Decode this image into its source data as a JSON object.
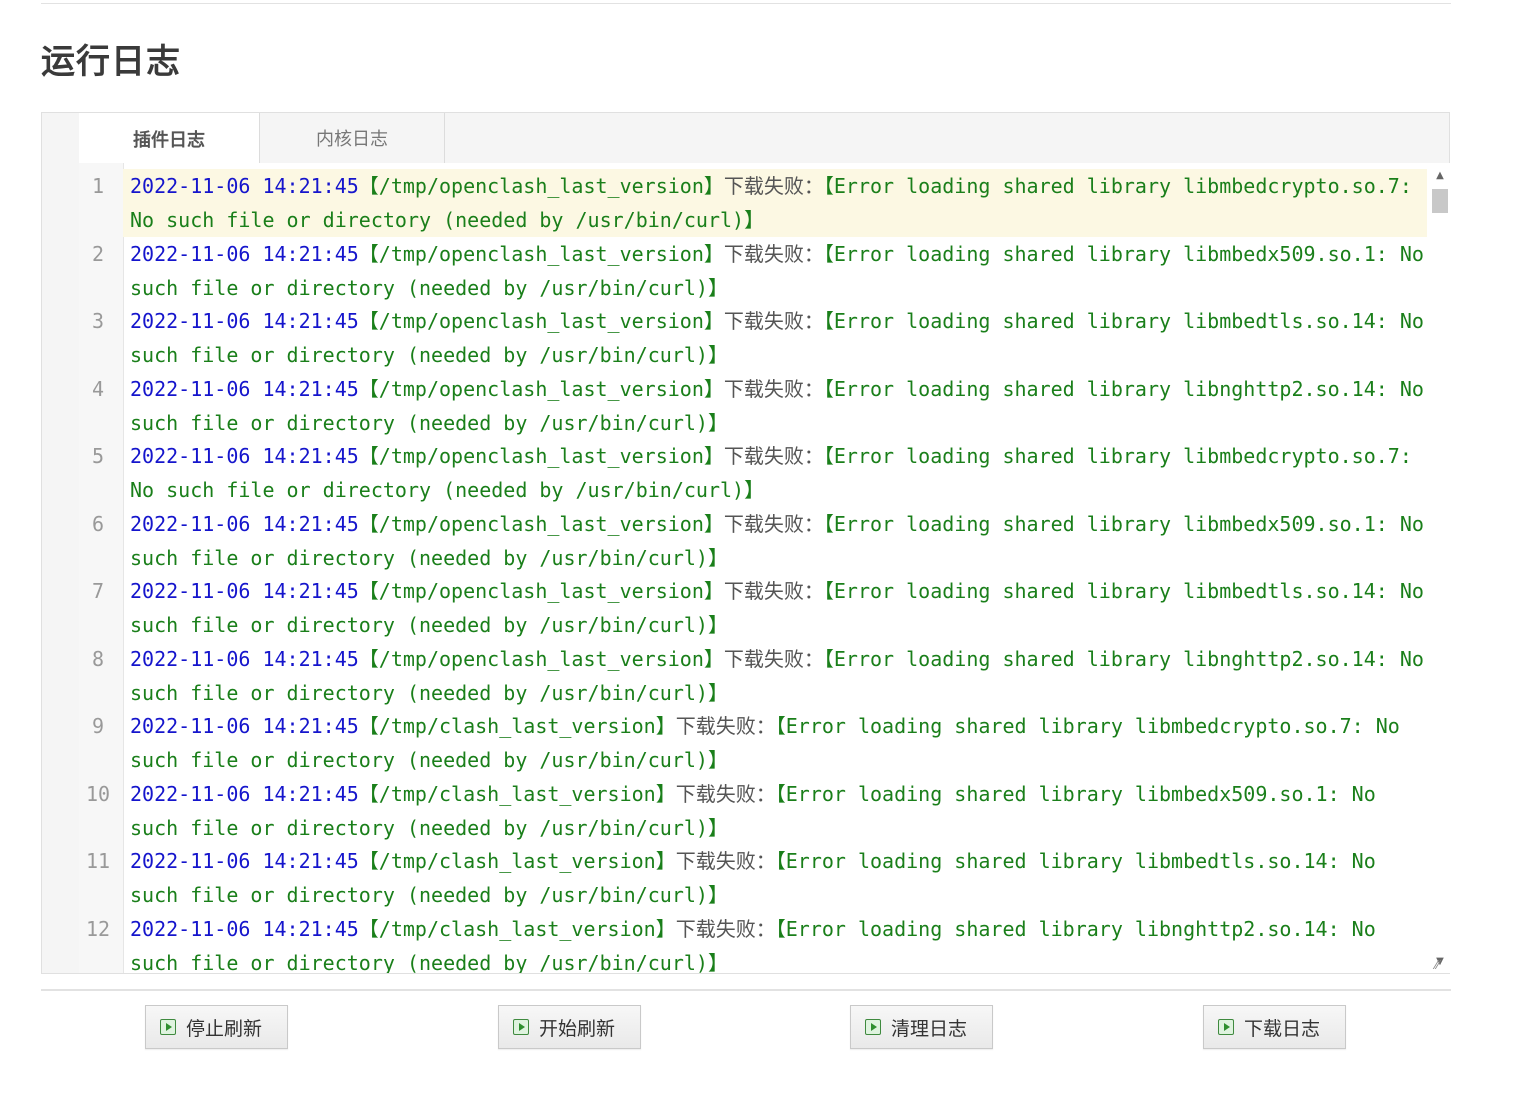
{
  "page": {
    "title": "运行日志"
  },
  "tabs": [
    {
      "label": "插件日志",
      "active": true
    },
    {
      "label": "内核日志",
      "active": false
    }
  ],
  "log_lines": [
    {
      "no": "1",
      "time": "2022-11-06 14:21:45",
      "path": "【/tmp/openclash_last_version】",
      "cn": "下载失败：",
      "msg": "【Error loading shared library libmbedcrypto.so.7: No such file or directory (needed by /usr/bin/curl)】"
    },
    {
      "no": "2",
      "time": "2022-11-06 14:21:45",
      "path": "【/tmp/openclash_last_version】",
      "cn": "下载失败：",
      "msg": "【Error loading shared library libmbedx509.so.1: No such file or directory (needed by /usr/bin/curl)】"
    },
    {
      "no": "3",
      "time": "2022-11-06 14:21:45",
      "path": "【/tmp/openclash_last_version】",
      "cn": "下载失败：",
      "msg": "【Error loading shared library libmbedtls.so.14: No such file or directory (needed by /usr/bin/curl)】"
    },
    {
      "no": "4",
      "time": "2022-11-06 14:21:45",
      "path": "【/tmp/openclash_last_version】",
      "cn": "下载失败：",
      "msg": "【Error loading shared library libnghttp2.so.14: No such file or directory (needed by /usr/bin/curl)】"
    },
    {
      "no": "5",
      "time": "2022-11-06 14:21:45",
      "path": "【/tmp/openclash_last_version】",
      "cn": "下载失败：",
      "msg": "【Error loading shared library libmbedcrypto.so.7: No such file or directory (needed by /usr/bin/curl)】"
    },
    {
      "no": "6",
      "time": "2022-11-06 14:21:45",
      "path": "【/tmp/openclash_last_version】",
      "cn": "下载失败：",
      "msg": "【Error loading shared library libmbedx509.so.1: No such file or directory (needed by /usr/bin/curl)】"
    },
    {
      "no": "7",
      "time": "2022-11-06 14:21:45",
      "path": "【/tmp/openclash_last_version】",
      "cn": "下载失败：",
      "msg": "【Error loading shared library libmbedtls.so.14: No such file or directory (needed by /usr/bin/curl)】"
    },
    {
      "no": "8",
      "time": "2022-11-06 14:21:45",
      "path": "【/tmp/openclash_last_version】",
      "cn": "下载失败：",
      "msg": "【Error loading shared library libnghttp2.so.14: No such file or directory (needed by /usr/bin/curl)】"
    },
    {
      "no": "9",
      "time": "2022-11-06 14:21:45",
      "path": "【/tmp/clash_last_version】",
      "cn": "下载失败：",
      "msg": "【Error loading shared library libmbedcrypto.so.7: No such file or directory (needed by /usr/bin/curl)】"
    },
    {
      "no": "10",
      "time": "2022-11-06 14:21:45",
      "path": "【/tmp/clash_last_version】",
      "cn": "下载失败：",
      "msg": "【Error loading shared library libmbedx509.so.1: No such file or directory (needed by /usr/bin/curl)】"
    },
    {
      "no": "11",
      "time": "2022-11-06 14:21:45",
      "path": "【/tmp/clash_last_version】",
      "cn": "下载失败：",
      "msg": "【Error loading shared library libmbedtls.so.14: No such file or directory (needed by /usr/bin/curl)】"
    },
    {
      "no": "12",
      "time": "2022-11-06 14:21:45",
      "path": "【/tmp/clash_last_version】",
      "cn": "下载失败：",
      "msg": "【Error loading shared library libnghttp2.so.14: No such file or directory (needed by /usr/bin/curl)】"
    }
  ],
  "buttons": {
    "stop_refresh": "停止刷新",
    "start_refresh": "开始刷新",
    "clear_log": "清理日志",
    "download_log": "下载日志"
  },
  "colors": {
    "timestamp": "#1515cc",
    "message": "#1a7f1a",
    "highlight_line": "#fcf8e3"
  }
}
